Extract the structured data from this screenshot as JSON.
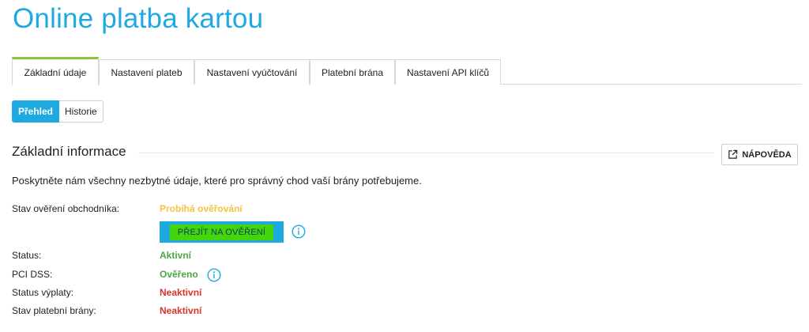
{
  "page": {
    "title": "Online platba kartou"
  },
  "tabs": [
    {
      "label": "Základní údaje",
      "active": true
    },
    {
      "label": "Nastavení plateb",
      "active": false
    },
    {
      "label": "Nastavení vyúčtování",
      "active": false
    },
    {
      "label": "Platební brána",
      "active": false
    },
    {
      "label": "Nastavení API klíčů",
      "active": false
    }
  ],
  "subtabs": [
    {
      "label": "Přehled",
      "active": true
    },
    {
      "label": "Historie",
      "active": false
    }
  ],
  "section": {
    "title": "Základní informace",
    "help_label": "NÁPOVĚDA",
    "intro": "Poskytněte nám všechny nezbytné údaje, které pro správný chod vaší brány potřebujeme."
  },
  "rows": {
    "merchant_verification": {
      "label": "Stav ověření obchodníka:",
      "value": "Probíhá ověřování"
    },
    "verify_button": "PŘEJÍT NA OVĚŘENÍ",
    "status": {
      "label": "Status:",
      "value": "Aktivní"
    },
    "pci": {
      "label": "PCI DSS:",
      "value": "Ověřeno"
    },
    "payout": {
      "label": "Status výplaty:",
      "value": "Neaktivní"
    },
    "gateway": {
      "label": "Stav platební brány:",
      "value": "Neaktivní"
    }
  },
  "colors": {
    "accent": "#1fa9e1",
    "tab_active_border": "#8bc53f",
    "pending": "#f5c242",
    "active": "#4aa843",
    "inactive": "#d9342b",
    "highlight": "#43d60a"
  },
  "icons": {
    "help": "external-link-icon",
    "info": "info-icon"
  }
}
